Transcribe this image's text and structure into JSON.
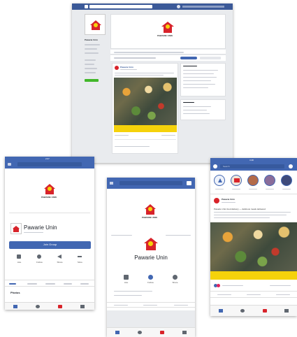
{
  "desktop": {
    "brand": "PAWARIE UNIN",
    "page_name": "Pawarie Unin",
    "nav_dot_label": "f"
  },
  "phone_left": {
    "time": "2:07",
    "brand": "PAWARIE UNIN",
    "page_name": "Pawarie Unin",
    "button_label": "Join Group",
    "actions": [
      "Like",
      "Follow",
      "Share",
      "More"
    ],
    "section": "Photos"
  },
  "phone_center": {
    "brand": "PAWARIE UNIN",
    "page_name": "Pawarie Unin",
    "actions": [
      "Like",
      "Follow",
      "Share"
    ]
  },
  "phone_right": {
    "time": "3:48",
    "search_placeholder": "Search",
    "post_author": "Pawarie Unin",
    "post_text": "Pawarie Unin food delivery — delicious meals delivered"
  },
  "colors": {
    "facebook_blue": "#3b5998",
    "accent_blue": "#4267b2",
    "brand_red": "#d8232a",
    "brand_yellow": "#f5d20b"
  }
}
